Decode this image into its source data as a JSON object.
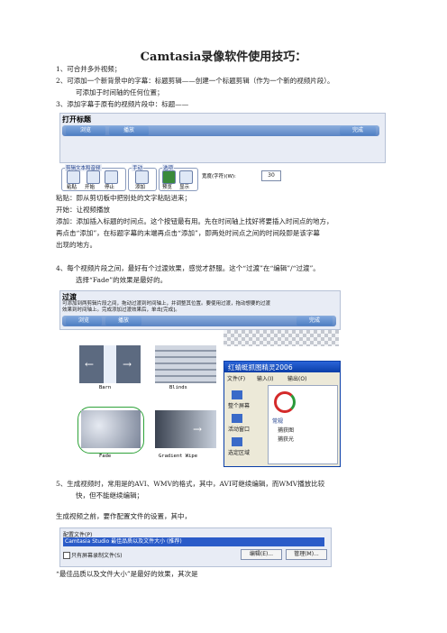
{
  "doc": {
    "title": "Camtasia录像软件使用技巧：",
    "items": [
      "1、可合并多外视频；",
      "2、可添加一个新背景中的字幕：标题剪辑——创建一个标题剪辑（作为一个新的视频片段）。",
      "可添加于时间轴的任何位置；",
      "3、添加字幕于原有的视频片段中：标题——"
    ],
    "para1": [
      "粘贴：即从剪切板中把别处的文字粘贴进来；",
      "开始：让视频播放",
      "添加：添加插入标题的时间点。这个按钮最有用。先在时间轴上找好将要插入时间点的地方，",
      "再点击“添加”，在标题字幕的末端再点击“添加”，即两处时间点之间的时间段即是该字幕",
      "出现的地方。"
    ],
    "item4": [
      "4、每个视频片段之间，最好有个过渡效果，感觉才舒服。这个“过渡”在“编辑”/“过渡”。",
      "选择“Fade”的效果是最好的。"
    ],
    "item5": [
      "5、生成视频时，常用是的AVI、WMV的格式，其中，AVI可继续编辑，而WMV播放比较",
      "快，但不能继续编辑；"
    ],
    "para2": "生成视频之前，要作配置文件的设置，其中，",
    "para3": "“最佳品质以及文件大小”是最好的效果，其次是"
  },
  "title_ui": {
    "header": "打开标题",
    "btn_browse": "浏览",
    "btn_preview": "播放",
    "btn_done": "完成",
    "group1": "剪辑文本和音频",
    "group2": "手动",
    "group3": "选项",
    "paste": "粘贴",
    "start": "开始",
    "stop": "停止",
    "add": "添加",
    "opt1": "预览",
    "opt2": "显示",
    "width_label": "宽度(字符)(W):",
    "width_value": "30"
  },
  "transition_ui": {
    "header": "过渡",
    "desc1": "可添加到两剪辑片段之间，拖动过渡到时间轴上，并调整其位置。要使用过渡，拖动想要的过渡",
    "desc2": "效果到时间轴上。完成添加过渡效果后，单击[完成]。",
    "btn_browse": "浏览",
    "btn_preview": "播放",
    "btn_done": "完成",
    "thumbs": [
      "Barn",
      "Blinds",
      "Fade",
      "Gradient Wipe"
    ],
    "win_title": "红蜻蜓抓图精灵2006",
    "win_menu": [
      "文件(F)",
      "输入(I)",
      "输出(O)"
    ],
    "win_side": [
      "整个屏幕",
      "活动窗口",
      "选定区域"
    ],
    "win_right": [
      "常规",
      "捕获图",
      "捕获光"
    ]
  },
  "profile_ui": {
    "label": "配置文件(P)",
    "selected": "Camtasia Studio 最佳品质以及文件大小 (推荐)",
    "checkbox": "只有屏幕录制文件(S)",
    "btn_edit": "编辑(E)...",
    "btn_manage": "管理(M)..."
  }
}
